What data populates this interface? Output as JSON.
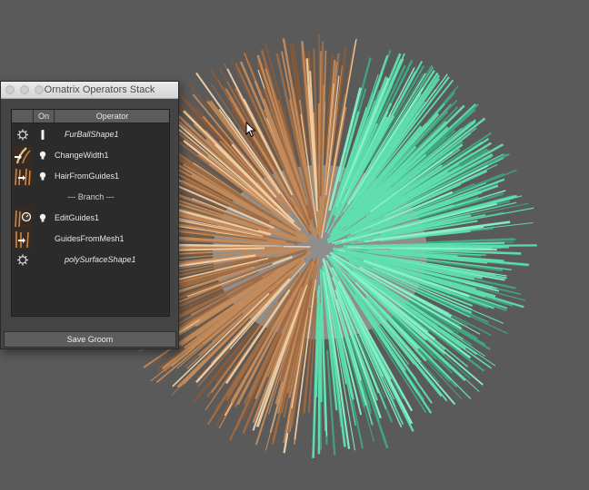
{
  "panel": {
    "title": "Ornatrix Operators Stack",
    "columns": {
      "on": "On",
      "operator": "Operator"
    },
    "rows": [
      {
        "label": "FurBallShape1",
        "style": "italic",
        "icon": "gear-icon",
        "on_icon": "pin-icon"
      },
      {
        "label": "ChangeWidth1",
        "style": "normal",
        "icon": "change-width-icon",
        "on_icon": "bulb-icon"
      },
      {
        "label": "HairFromGuides1",
        "style": "normal",
        "icon": "hair-from-guides-icon",
        "on_icon": "bulb-icon"
      },
      {
        "label": "--- Branch ---",
        "style": "center",
        "icon": "",
        "on_icon": ""
      },
      {
        "label": "EditGuides1",
        "style": "normal",
        "icon": "edit-guides-icon",
        "on_icon": "bulb-icon"
      },
      {
        "label": "GuidesFromMesh1",
        "style": "normal",
        "icon": "guides-from-mesh-icon",
        "on_icon": ""
      },
      {
        "label": "polySurfaceShape1",
        "style": "italic",
        "icon": "gear-icon",
        "on_icon": ""
      }
    ],
    "save_label": "Save Groom"
  },
  "colors": {
    "viewport_bg": "#595959",
    "fur_brown": "#c48a5a",
    "fur_green": "#5fe0b0",
    "sphere_gray": "#8e8e8e"
  }
}
